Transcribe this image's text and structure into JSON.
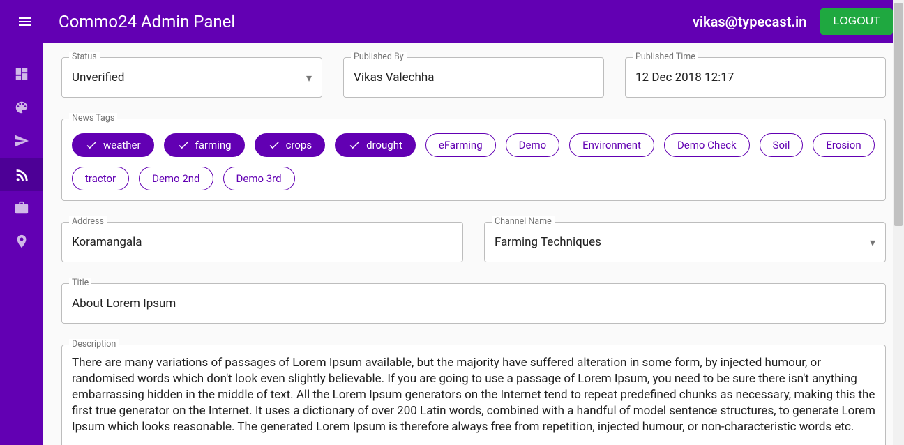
{
  "header": {
    "title": "Commo24 Admin Panel",
    "user_email": "vikas@typecast.in",
    "logout_label": "LOGOUT"
  },
  "sidebar": {
    "items": [
      {
        "name": "dashboard-icon"
      },
      {
        "name": "palette-icon"
      },
      {
        "name": "send-icon"
      },
      {
        "name": "rss-icon",
        "active": true
      },
      {
        "name": "briefcase-icon"
      },
      {
        "name": "location-icon"
      }
    ]
  },
  "form": {
    "status": {
      "label": "Status",
      "value": "Unverified"
    },
    "published_by": {
      "label": "Published By",
      "value": "Vikas Valechha"
    },
    "published_time": {
      "label": "Published Time",
      "value": "12 Dec 2018 12:17"
    },
    "news_tags": {
      "label": "News Tags",
      "chips": [
        {
          "label": "weather",
          "selected": true
        },
        {
          "label": "farming",
          "selected": true
        },
        {
          "label": "crops",
          "selected": true
        },
        {
          "label": "drought",
          "selected": true
        },
        {
          "label": "eFarming",
          "selected": false
        },
        {
          "label": "Demo",
          "selected": false
        },
        {
          "label": "Environment",
          "selected": false
        },
        {
          "label": "Demo Check",
          "selected": false
        },
        {
          "label": "Soil",
          "selected": false
        },
        {
          "label": "Erosion",
          "selected": false
        },
        {
          "label": "tractor",
          "selected": false
        },
        {
          "label": "Demo 2nd",
          "selected": false
        },
        {
          "label": "Demo 3rd",
          "selected": false
        }
      ]
    },
    "address": {
      "label": "Address",
      "value": "Koramangala"
    },
    "channel_name": {
      "label": "Channel Name",
      "value": "Farming Techniques"
    },
    "title_field": {
      "label": "Title",
      "value": "About Lorem Ipsum"
    },
    "description": {
      "label": "Description",
      "value": "There are many variations of passages of Lorem Ipsum available, but the majority have suffered alteration in some form, by injected humour, or randomised words which don't look even slightly believable. If you are going to use a passage of Lorem Ipsum, you need to be sure there isn't anything embarrassing hidden in the middle of text. All the Lorem Ipsum generators on the Internet tend to repeat predefined chunks as necessary, making this the first true generator on the Internet. It uses a dictionary of over 200 Latin words, combined with a handful of model sentence structures, to generate Lorem Ipsum which looks reasonable. The generated Lorem Ipsum is therefore always free from repetition, injected humour, or non-characteristic words etc."
    }
  }
}
